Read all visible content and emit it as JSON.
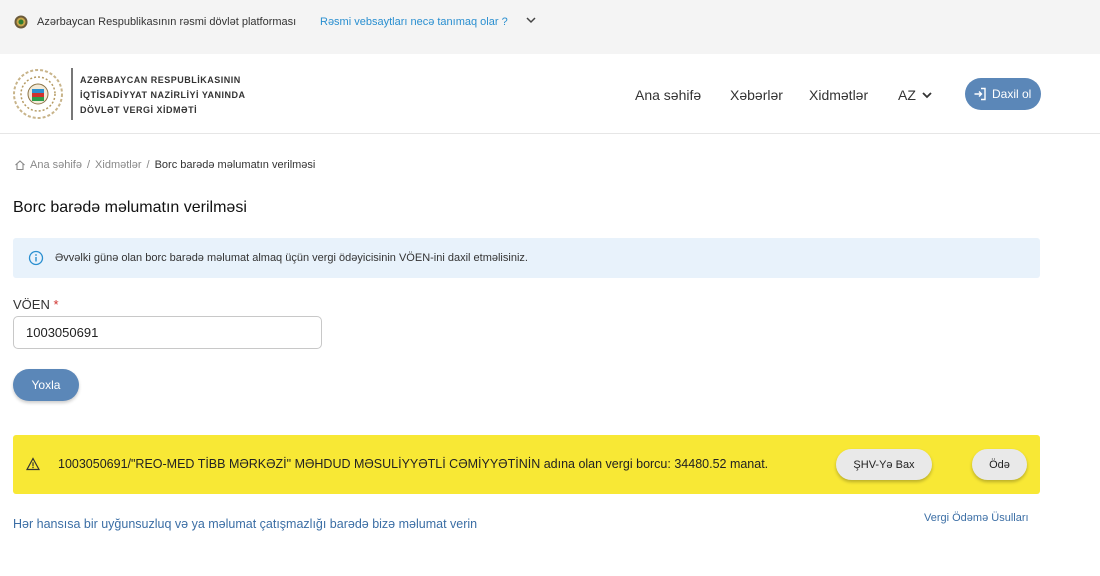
{
  "topbar": {
    "official_text": "Azərbaycan Respublikasının rəsmi dövlət platforması",
    "howto_link": "Rəsmi vebsaytları necə tanımaq olar ?"
  },
  "header": {
    "org_line1": "AZƏRBAYCAN RESPUBLİKASININ",
    "org_line2": "İQTİSADİYYAT NAZİRLİYİ YANINDA",
    "org_line3": "DÖVLƏT VERGİ XİDMƏTİ",
    "nav": {
      "home": "Ana səhifə",
      "news": "Xəbərlər",
      "services": "Xidmətlər"
    },
    "lang": "AZ",
    "login_label": "Daxil ol"
  },
  "breadcrumb": {
    "home": "Ana səhifə",
    "services": "Xidmətlər",
    "current": "Borc barədə məlumatın verilməsi",
    "separator": "/"
  },
  "page_title": "Borc barədə məlumatın verilməsi",
  "info_text": "Əvvəlki günə olan borc barədə məlumat almaq üçün vergi ödəyicisinin VÖEN-ini daxil etməlisiniz.",
  "form": {
    "voen_label": "VÖEN",
    "required_mark": "*",
    "voen_value": "1003050691",
    "check_label": "Yoxla"
  },
  "result": {
    "text": "1003050691/\"REO-MED TİBB MƏRKƏZİ\" MƏHDUD MƏSULİYYƏTLİ CƏMİYYƏTİNİN adına olan vergi borcu: 34480.52 manat.",
    "shv_label": "ŞHV-Yə Bax",
    "pay_label": "Ödə"
  },
  "footer_links": {
    "report": "Hər hansısa bir uyğunsuzluq və ya məlumat çatışmazlığı barədə bizə məlumat verin",
    "methods": "Vergi Ödəmə Üsulları"
  },
  "colors": {
    "primary_button": "#5b87b8",
    "result_background": "#f8e835",
    "info_background": "#e8f2fb",
    "link": "#3b6ea5"
  }
}
